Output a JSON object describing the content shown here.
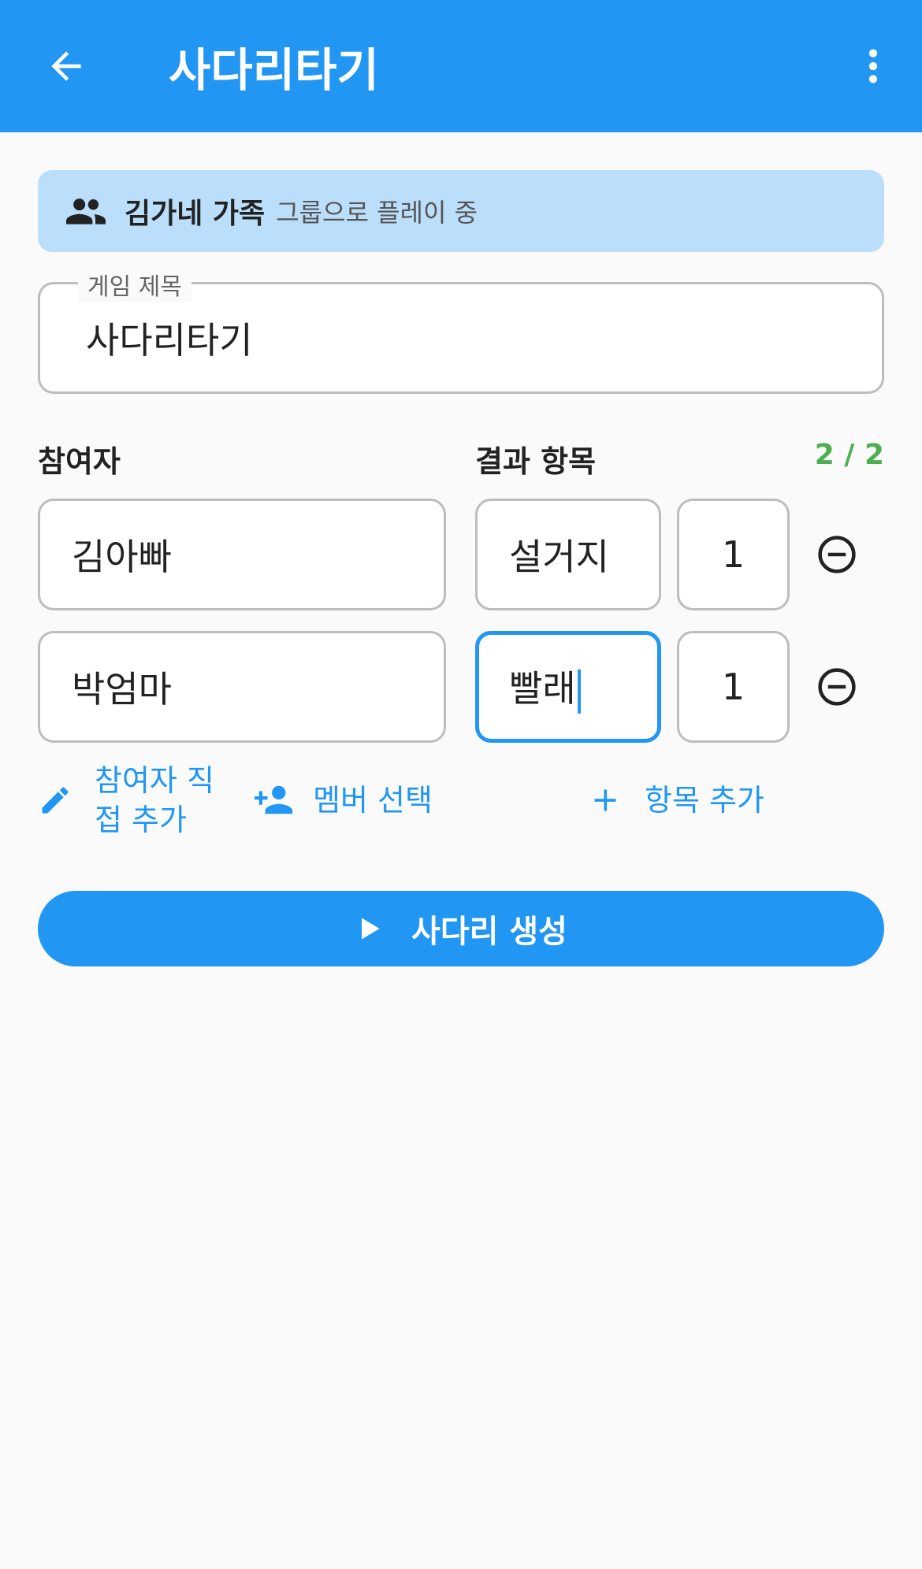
{
  "appbar": {
    "title": "사다리타기",
    "back_icon": "arrow-back-icon",
    "more_icon": "more-vert-icon",
    "background": "#2196f3"
  },
  "banner": {
    "icon": "group-icon",
    "group_name": "김가네 가족",
    "suffix": "그룹으로 플레이 중",
    "background": "#bbdefb"
  },
  "game_title": {
    "label": "게임 제목",
    "value": "사다리타기"
  },
  "participants": {
    "header": "참여자",
    "items": [
      "김아빠",
      "박엄마"
    ]
  },
  "results": {
    "header": "결과 항목",
    "count_label": "2 / 2",
    "items": [
      {
        "name": "설거지",
        "quantity": "1"
      },
      {
        "name": "빨래",
        "quantity": "1"
      }
    ]
  },
  "actions": {
    "add_participant_line1": "참여자 직",
    "add_participant_line2": "접 추가",
    "select_member": "멤버 선택",
    "add_item": "항목 추가"
  },
  "primary_button": {
    "label": "사다리 생성",
    "icon": "play-icon"
  },
  "colors": {
    "accent": "#2196f3",
    "success": "#4caf50"
  }
}
